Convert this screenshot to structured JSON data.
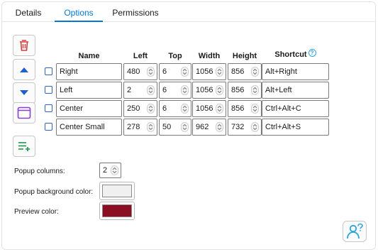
{
  "tabs": [
    {
      "label": "Details",
      "active": false
    },
    {
      "label": "Options",
      "active": true
    },
    {
      "label": "Permissions",
      "active": false
    }
  ],
  "sidebar_icons": [
    "trash-icon",
    "arrow-up-icon",
    "arrow-down-icon",
    "window-icon",
    "add-list-icon"
  ],
  "table": {
    "headers": {
      "name": "Name",
      "left": "Left",
      "top": "Top",
      "width": "Width",
      "height": "Height",
      "shortcut": "Shortcut"
    },
    "help_glyph": "?",
    "rows": [
      {
        "name": "Right",
        "left": "480",
        "top": "6",
        "width": "1056",
        "height": "856",
        "shortcut": "Alt+Right"
      },
      {
        "name": "Left",
        "left": "2",
        "top": "6",
        "width": "1056",
        "height": "856",
        "shortcut": "Alt+Left"
      },
      {
        "name": "Center",
        "left": "250",
        "top": "6",
        "width": "1056",
        "height": "856",
        "shortcut": "Ctrl+Alt+C"
      },
      {
        "name": "Center Small",
        "left": "278",
        "top": "50",
        "width": "962",
        "height": "732",
        "shortcut": "Ctrl+Alt+S"
      }
    ]
  },
  "settings": {
    "popup_columns_label": "Popup columns:",
    "popup_columns_value": "2",
    "popup_bg_label": "Popup background color:",
    "popup_bg_color": "#f0f0f0",
    "preview_label": "Preview color:",
    "preview_color": "#8b0e22"
  },
  "colors": {
    "accent": "#0078d4",
    "trash": "#d83b3b",
    "arrow": "#1f5fd1",
    "add": "#2e9e5b",
    "help": "#2aa5d8"
  }
}
